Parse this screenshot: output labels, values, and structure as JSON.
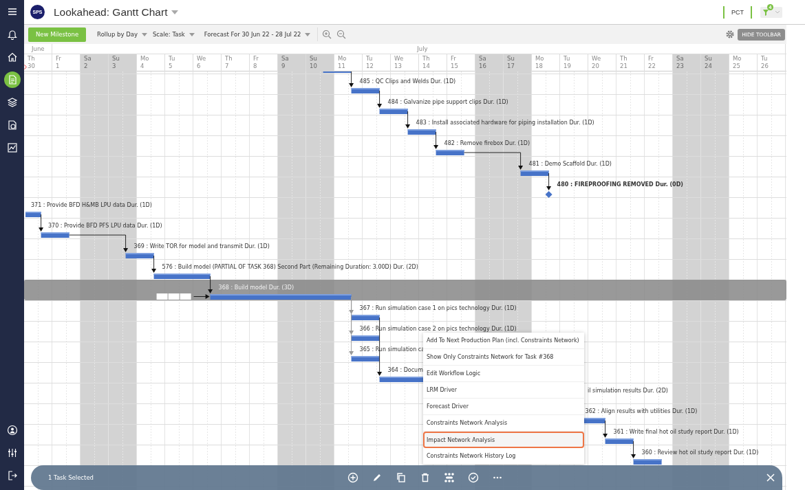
{
  "sidebar": {
    "items": [
      {
        "selected": false
      },
      {
        "selected": false
      },
      {
        "selected": false
      },
      {
        "selected": true
      },
      {
        "selected": false
      },
      {
        "selected": false
      },
      {
        "selected": false
      },
      {
        "selected": false
      },
      {
        "selected": false
      },
      {
        "selected": false
      }
    ]
  },
  "header": {
    "logo": "SPS",
    "title": "Lookahead: Gantt Chart",
    "pct": "PCT",
    "filter_count": "4"
  },
  "toolbar": {
    "new_button": "New Milestone",
    "dropdowns": [
      "Rollup by Day",
      "Scale: Task",
      "Forecast For 30 Jun 22 - 28 Jul 22"
    ],
    "hide_button": "HIDE TOOLBAR"
  },
  "timeline": {
    "months": [
      {
        "label": "June",
        "days": [
          {
            "weekday": "Th",
            "date": "30",
            "weekend": false
          }
        ]
      },
      {
        "label": "July",
        "days": [
          {
            "weekday": "Fr",
            "date": "1",
            "weekend": false
          },
          {
            "weekday": "Sa",
            "date": "2",
            "weekend": true
          },
          {
            "weekday": "Su",
            "date": "3",
            "weekend": true
          },
          {
            "weekday": "Mo",
            "date": "4",
            "weekend": false
          },
          {
            "weekday": "Tu",
            "date": "5",
            "weekend": false
          },
          {
            "weekday": "We",
            "date": "6",
            "weekend": false
          },
          {
            "weekday": "Th",
            "date": "7",
            "weekend": false
          },
          {
            "weekday": "Fr",
            "date": "8",
            "weekend": false
          },
          {
            "weekday": "Sa",
            "date": "9",
            "weekend": true
          },
          {
            "weekday": "Su",
            "date": "10",
            "weekend": true
          },
          {
            "weekday": "Mo",
            "date": "11",
            "weekend": false
          },
          {
            "weekday": "Tu",
            "date": "12",
            "weekend": false
          },
          {
            "weekday": "We",
            "date": "13",
            "weekend": false
          },
          {
            "weekday": "Th",
            "date": "14",
            "weekend": false
          },
          {
            "weekday": "Fr",
            "date": "15",
            "weekend": false
          },
          {
            "weekday": "Sa",
            "date": "16",
            "weekend": true
          },
          {
            "weekday": "Su",
            "date": "17",
            "weekend": true
          },
          {
            "weekday": "Mo",
            "date": "18",
            "weekend": false
          },
          {
            "weekday": "Tu",
            "date": "19",
            "weekend": false
          },
          {
            "weekday": "We",
            "date": "20",
            "weekend": false
          },
          {
            "weekday": "Th",
            "date": "21",
            "weekend": false
          },
          {
            "weekday": "Fr",
            "date": "22",
            "weekend": false
          },
          {
            "weekday": "Sa",
            "date": "23",
            "weekend": true
          },
          {
            "weekday": "Su",
            "date": "24",
            "weekend": true
          },
          {
            "weekday": "Mo",
            "date": "25",
            "weekend": false
          },
          {
            "weekday": "Tu",
            "date": "26",
            "weekend": false
          }
        ]
      }
    ]
  },
  "rows": [
    {
      "kind": "task",
      "selected": false
    },
    {
      "kind": "task",
      "label": "485 : QC Clips and Welds Dur. (1D)",
      "selected": false
    },
    {
      "kind": "task",
      "label": "484 : Galvanize pipe support clips Dur. (1D)",
      "selected": false
    },
    {
      "kind": "task",
      "label": "483 : Install associated hardware for piping installation Dur. (1D)",
      "selected": false
    },
    {
      "kind": "task",
      "label": "482 : Remove firebox Dur. (1D)",
      "selected": false
    },
    {
      "kind": "task",
      "label": "481 : Demo Scaffold Dur. (1D)",
      "selected": false
    },
    {
      "kind": "milestone",
      "label": "480 : FIREPROOFING REMOVED Dur. (0D)",
      "selected": false
    },
    {
      "kind": "task",
      "label": "371 : Provide BFD H&MB LPU data Dur. (1D)",
      "selected": false
    },
    {
      "kind": "task",
      "label": "370 : Provide BFD PFS LPU data Dur. (1D)",
      "selected": false
    },
    {
      "kind": "task",
      "label": "369 : Write TOR for model and transmit Dur. (1D)",
      "selected": false
    },
    {
      "kind": "task",
      "label": "576 : Build model (PARTIAL OF TASK 368) Second Part (Remaining Duration: 3.00D) Dur. (2D)",
      "selected": false
    },
    {
      "kind": "task",
      "label": "368 : Build model Dur. (3D)",
      "selected": true
    },
    {
      "kind": "task",
      "label": "367 : Run simulation case 1 on pics technology Dur. (1D)",
      "selected": false
    },
    {
      "kind": "task",
      "label": "366 : Run simulation case 2 on pics technology Dur. (1D)",
      "selected": false
    },
    {
      "kind": "task",
      "label": "365 : Run simulation ca",
      "selected": false
    },
    {
      "kind": "task",
      "label": "364 : Docum",
      "selected": false
    },
    {
      "kind": "task",
      "label": "il simulation results Dur. (2D)",
      "selected": false
    },
    {
      "kind": "task",
      "label": "362 : Align results with utilities Dur. (1D)",
      "selected": false
    },
    {
      "kind": "task",
      "label": "361 : Write final hot oil study report Dur. (1D)",
      "selected": false
    },
    {
      "kind": "task",
      "label": "360 : Review hot oil study report Dur. (1D)",
      "selected": false
    }
  ],
  "context_menu": {
    "items": [
      {
        "label": "Add To Next Production Plan (incl. Constraints Network)",
        "selected": false
      },
      {
        "label": "Show Only Constraints Network for Task #368",
        "selected": false
      },
      {
        "label": "Edit Workflow Logic",
        "selected": false
      },
      {
        "label": "LRM Driver",
        "selected": false
      },
      {
        "label": "Forecast Driver",
        "selected": false
      },
      {
        "label": "Constraints Network Analysis",
        "selected": false
      },
      {
        "label": "Impact Network Analysis",
        "selected": true
      },
      {
        "label": "Constraints Network History Log",
        "selected": false
      }
    ]
  },
  "selection_bar": {
    "label": "1 Task Selected"
  }
}
